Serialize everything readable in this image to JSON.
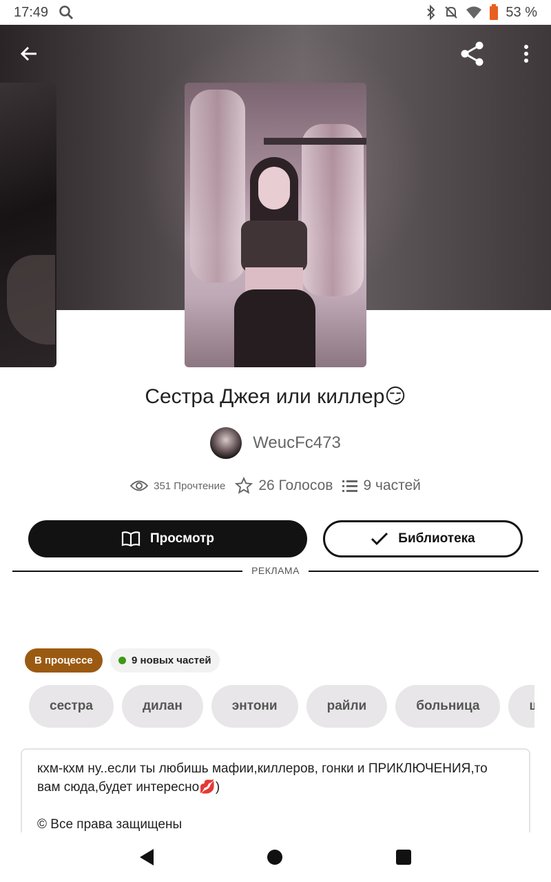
{
  "status_bar": {
    "time": "17:49",
    "battery": "53 %"
  },
  "story": {
    "title": "Сестра Джея или киллер😏",
    "author": "WeucFc473",
    "reads": "351 Прочтение",
    "votes": "26 Голосов",
    "parts": "9 частей"
  },
  "actions": {
    "read_label": "Просмотр",
    "library_label": "Библиотека"
  },
  "ad_label": "РЕКЛАМА",
  "badges": {
    "status": "В процессе",
    "new_parts": "9 новых частей"
  },
  "tags": [
    "сестра",
    "дилан",
    "энтони",
    "райли",
    "больница",
    "шк"
  ],
  "description": {
    "line1": "кхм-кхм ну..если ты любишь мафии,киллеров, гонки и ПРИКЛЮЧЕНИЯ,то вам сюда,будет интересно💋)",
    "line2": "© Все права защищены"
  },
  "colors": {
    "status_badge": "#9b5a12",
    "new_dot": "#3d9a14",
    "primary_button": "#121212"
  },
  "icons": {
    "back": "arrow-left-icon",
    "share": "share-icon",
    "more": "more-vertical-icon",
    "reads": "eye-icon",
    "votes": "star-icon",
    "parts": "list-icon",
    "read": "book-icon",
    "library": "check-icon"
  }
}
